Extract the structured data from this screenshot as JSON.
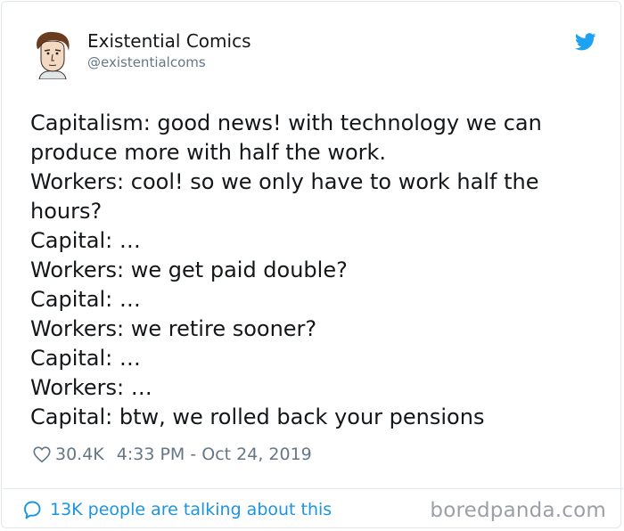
{
  "author": {
    "display_name": "Existential Comics",
    "handle": "@existentialcoms"
  },
  "tweet": {
    "lines": [
      "Capitalism: good news! with technology we can produce more with half the work.",
      "Workers: cool! so we only have to work half the hours?",
      "Capital: …",
      "Workers: we get paid double?",
      "Capital: …",
      "Workers: we retire sooner?",
      "Capital: …",
      "Workers: …",
      "Capital: btw, we rolled back your pensions"
    ]
  },
  "meta": {
    "likes": "30.4K",
    "timestamp": "4:33 PM - Oct 24, 2019"
  },
  "footer": {
    "talking": "13K people are talking about this",
    "watermark": "boredpanda.com"
  },
  "icons": {
    "brand": "twitter-bird-icon",
    "like": "heart-icon",
    "conversation": "speech-bubble-icon"
  },
  "colors": {
    "twitter_blue": "#1da1f2",
    "link_blue": "#1b95e0",
    "muted": "#657786",
    "text": "#14171a",
    "border": "#e1e8ed"
  }
}
